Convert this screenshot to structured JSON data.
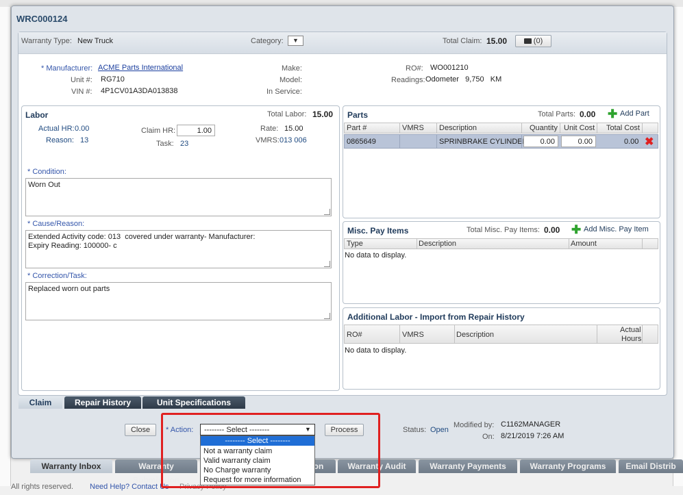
{
  "modal_title": "WRC000124",
  "header": {
    "warranty_type_label": "Warranty Type:",
    "warranty_type_value": "New Truck",
    "category_label": "Category:",
    "total_claim_label": "Total Claim:",
    "total_claim_value": "15.00",
    "attach_count": "(0)"
  },
  "unit": {
    "manufacturer_label": "* Manufacturer:",
    "manufacturer_value": "ACME Parts International",
    "unit_label": "Unit #:",
    "unit_value": "RG710",
    "vin_label": "VIN #:",
    "vin_value": "4P1CV01A3DA013838",
    "make_label": "Make:",
    "model_label": "Model:",
    "in_service_label": "In Service:",
    "ro_label": "RO#:",
    "ro_value": "WO001210",
    "readings_label": "Readings:",
    "readings_value": "Odometer   9,750   KM"
  },
  "labor": {
    "title": "Labor",
    "total_label": "Total Labor:",
    "total_value": "15.00",
    "actual_hr_label": "Actual HR:",
    "actual_hr_value": "0.00",
    "reason_label": "Reason:",
    "reason_value": "13",
    "claim_hr_label": "Claim HR:",
    "claim_hr_value": "1.00",
    "task_label": "Task:",
    "task_value": "23",
    "rate_label": "Rate:",
    "rate_value": "15.00",
    "vmrs_label": "VMRS:",
    "vmrs_value": "013 006",
    "condition_label": "* Condition:",
    "condition_value": "Worn Out",
    "cause_label": "* Cause/Reason:",
    "cause_value": "Extended Activity code: 013  covered under warranty- Manufacturer:\nExpiry Reading: 100000- c",
    "correction_label": "* Correction/Task:",
    "correction_value": "Replaced worn out parts"
  },
  "parts": {
    "title": "Parts",
    "total_label": "Total Parts:",
    "total_value": "0.00",
    "add_label": "Add Part",
    "columns": [
      "Part #",
      "VMRS",
      "Description",
      "Quantity",
      "Unit Cost",
      "Total Cost"
    ],
    "rows": [
      {
        "part": "0865649",
        "vmrs": "",
        "description": "SPRINBRAKE CYLINDER",
        "quantity": "0.00",
        "unit_cost": "0.00",
        "total_cost": "0.00"
      }
    ]
  },
  "misc": {
    "title": "Misc. Pay Items",
    "total_label": "Total Misc. Pay Items:",
    "total_value": "0.00",
    "add_label": "Add Misc. Pay Item",
    "columns": [
      "Type",
      "Description",
      "Amount"
    ],
    "empty": "No data to display."
  },
  "additional": {
    "title": "Additional Labor - Import from Repair History",
    "columns": [
      "RO#",
      "VMRS",
      "Description",
      "Actual",
      "Hours"
    ],
    "empty": "No data to display."
  },
  "tabs": [
    "Claim",
    "Repair History",
    "Unit Specifications"
  ],
  "footer": {
    "close_label": "Close",
    "action_label": "* Action:",
    "action_selected": "-------- Select --------",
    "process_label": "Process",
    "status_label": "Status:",
    "status_value": "Open",
    "modified_by_label": "Modified by:",
    "modified_by_value": "C1162MANAGER",
    "on_label": "On:",
    "on_value": "8/21/2019 7:26 AM"
  },
  "dropdown_options": [
    "-------- Select --------",
    "Not a warranty claim",
    "Valid warranty claim",
    "No Charge warranty",
    "Request for more information"
  ],
  "bottom_tabs": [
    "Warranty Inbox",
    "Warranty Submission",
    "on",
    "Warranty Audit",
    "Warranty Payments",
    "Warranty Programs",
    "Email Distrib"
  ],
  "copyright": "All rights reserved.",
  "help_link": "Need Help? Contact Us",
  "privacy": "Privacy Policy",
  "colors": {
    "accent": "#1a3e9e",
    "highlight_red": "#e02020",
    "selected_row": "#b9c4d8"
  }
}
